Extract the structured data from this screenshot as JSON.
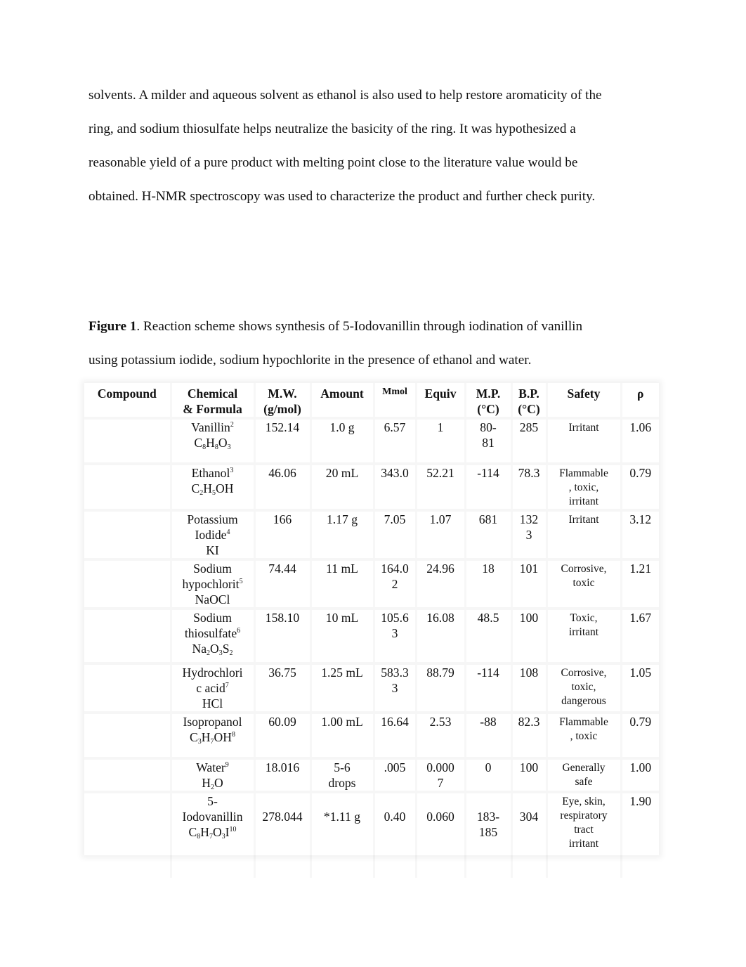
{
  "body_paragraph": {
    "lines": [
      "solvents.  A milder and aqueous solvent as ethanol is also used to help restore aromaticity of the",
      "ring, and sodium thiosulfate helps neutralize the basicity of the ring. It was hypothesized a",
      "reasonable yield of a pure product with melting point close to the literature value would be",
      "obtained. H-NMR spectroscopy was used to characterize the product and further check purity."
    ]
  },
  "figure_caption": {
    "label": "Figure 1",
    "line1": ". Reaction scheme shows synthesis of 5-Iodovanillin through iodination of vanillin",
    "line2": "using potassium iodide, sodium hypochlorite in the presence of ethanol and water."
  },
  "table": {
    "headers": {
      "compound": "Compound",
      "chemical_1": "Chemical",
      "chemical_2": "& Formula",
      "mw_1": "M.W.",
      "mw_2": "(g/mol)",
      "amount": "Amount",
      "mmol": "Mmol",
      "equiv": "Equiv",
      "mp_1": "M.P.",
      "mp_2": "(°C)",
      "bp_1": "B.P.",
      "bp_2": "(°C)",
      "safety": "Safety",
      "density": "ρ"
    },
    "rows": [
      {
        "compound": "",
        "name_lines": [
          "Vanillin"
        ],
        "name_ref": "2",
        "formula": [
          [
            "C",
            ""
          ],
          [
            "8",
            "sub"
          ],
          [
            "H",
            ""
          ],
          [
            "8",
            "sub"
          ],
          [
            "O",
            ""
          ],
          [
            "3",
            "sub"
          ]
        ],
        "mw": "152.14",
        "amount": "1.0 g",
        "mmol": "6.57",
        "equiv": "1",
        "mp": [
          "80-",
          "81"
        ],
        "bp": [
          "285"
        ],
        "safety": [
          "Irritant"
        ],
        "density": "1.06"
      },
      {
        "compound": "",
        "name_lines": [
          "Ethanol"
        ],
        "name_ref": "3",
        "formula": [
          [
            "C",
            ""
          ],
          [
            "2",
            "sub"
          ],
          [
            "H",
            ""
          ],
          [
            "5",
            "sub"
          ],
          [
            "OH",
            ""
          ]
        ],
        "mw": "46.06",
        "amount": "20 mL",
        "mmol": "343.0",
        "equiv": "52.21",
        "mp": [
          "-114"
        ],
        "bp": [
          "78.3"
        ],
        "safety": [
          "Flammable",
          ", toxic,",
          "irritant"
        ],
        "density": "0.79"
      },
      {
        "compound": "",
        "name_lines": [
          "Potassium",
          "Iodide"
        ],
        "name_ref": "4",
        "formula": [
          [
            "KI",
            ""
          ]
        ],
        "mw": "166",
        "amount": "1.17 g",
        "mmol": "7.05",
        "equiv": "1.07",
        "mp": [
          "681"
        ],
        "bp": [
          "132",
          "3"
        ],
        "safety": [
          "Irritant"
        ],
        "density": "3.12"
      },
      {
        "compound": "",
        "name_lines": [
          "Sodium",
          "hypochlorit"
        ],
        "name_ref": "5",
        "formula": [
          [
            "NaOCl",
            ""
          ]
        ],
        "mw": "74.44",
        "amount": "11 mL",
        "mmol": [
          "164.0",
          "2"
        ],
        "equiv": "24.96",
        "mp": [
          "18"
        ],
        "bp": [
          "101"
        ],
        "safety": [
          "Corrosive,",
          "toxic"
        ],
        "density": "1.21"
      },
      {
        "compound": "",
        "name_lines": [
          "Sodium",
          "thiosulfate"
        ],
        "name_ref": "6",
        "formula": [
          [
            "Na",
            ""
          ],
          [
            "2",
            "sub"
          ],
          [
            "O",
            ""
          ],
          [
            "3",
            "sub"
          ],
          [
            "S",
            ""
          ],
          [
            "2",
            "sub"
          ]
        ],
        "mw": "158.10",
        "amount": "10 mL",
        "mmol": [
          "105.6",
          "3"
        ],
        "equiv": "16.08",
        "mp": [
          "48.5"
        ],
        "bp": [
          "100"
        ],
        "safety": [
          "Toxic,",
          "irritant"
        ],
        "density": "1.67"
      },
      {
        "compound": "",
        "name_lines": [
          "Hydrochlori",
          "c acid"
        ],
        "name_ref": "7",
        "formula": [
          [
            "HCl",
            ""
          ]
        ],
        "mw": "36.75",
        "amount": "1.25 mL",
        "mmol": [
          "583.3",
          "3"
        ],
        "equiv": "88.79",
        "mp": [
          "-114"
        ],
        "bp": [
          "108"
        ],
        "safety": [
          "Corrosive,",
          "toxic,",
          "dangerous"
        ],
        "density": "1.05"
      },
      {
        "compound": "",
        "name_lines": [
          "Isopropanol"
        ],
        "name_ref": "",
        "formula": [
          [
            "C",
            ""
          ],
          [
            "3",
            "sub"
          ],
          [
            "H",
            ""
          ],
          [
            "7",
            "sub"
          ],
          [
            "OH",
            ""
          ],
          [
            "8",
            "sup"
          ]
        ],
        "mw": "60.09",
        "amount": "1.00 mL",
        "mmol": "16.64",
        "equiv": "2.53",
        "mp": [
          "-88"
        ],
        "bp": [
          "82.3"
        ],
        "safety": [
          "Flammable",
          ", toxic"
        ],
        "density": "0.79"
      },
      {
        "compound": "",
        "name_lines": [
          "Water"
        ],
        "name_ref": "9",
        "formula": [
          [
            "H",
            ""
          ],
          [
            "2",
            "sub"
          ],
          [
            "O",
            ""
          ]
        ],
        "mw": "18.016",
        "amount": [
          "5-6",
          "drops"
        ],
        "mmol": ".005",
        "equiv": [
          "0.000",
          "7"
        ],
        "mp": [
          "0"
        ],
        "bp": [
          "100"
        ],
        "safety": [
          "Generally",
          "safe"
        ],
        "density": "1.00"
      },
      {
        "compound": "",
        "name_lines": [
          "5-",
          "Iodovanillin"
        ],
        "name_ref": "",
        "formula": [
          [
            "C",
            ""
          ],
          [
            "8",
            "sub"
          ],
          [
            "H",
            ""
          ],
          [
            "7",
            "sub"
          ],
          [
            "O",
            ""
          ],
          [
            "3",
            "sub"
          ],
          [
            "I",
            ""
          ],
          [
            "10",
            "sup"
          ]
        ],
        "mw": "278.044",
        "amount": "*1.11 g",
        "mmol": "0.40",
        "equiv": "0.060",
        "mp": [
          "183-",
          "185"
        ],
        "bp": [
          "304"
        ],
        "safety": [
          "Eye, skin,",
          "respiratory",
          "tract",
          "irritant"
        ],
        "density": "1.90"
      }
    ]
  }
}
